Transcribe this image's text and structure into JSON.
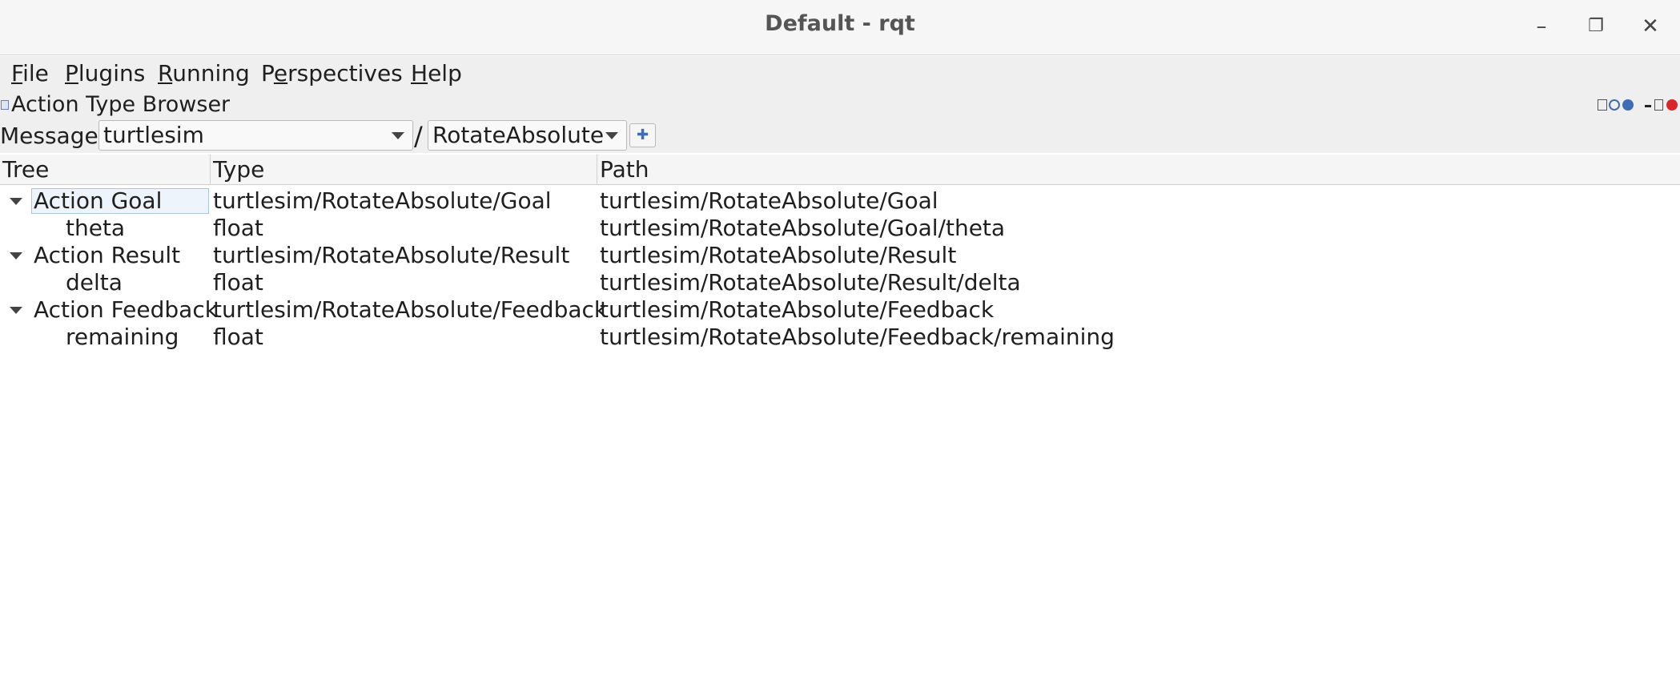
{
  "window": {
    "title": "Default - rqt",
    "minimize_glyph": "–",
    "maximize_glyph": "❐",
    "close_glyph": "✕"
  },
  "menubar": {
    "items": [
      {
        "first": "F",
        "rest": "ile"
      },
      {
        "first": "P",
        "rest": "lugins"
      },
      {
        "first": "R",
        "rest": "unning"
      },
      {
        "pre": "P",
        "first": "e",
        "rest": "rspectives"
      },
      {
        "first": "H",
        "rest": "elp"
      }
    ]
  },
  "plugin": {
    "title": "Action Type Browser"
  },
  "toolbar": {
    "message_label": "Message:",
    "package_value": "turtlesim",
    "separator": "/",
    "action_value": "RotateAbsolute",
    "add_button_glyph": "✚"
  },
  "tree": {
    "columns": [
      "Tree",
      "Type",
      "Path"
    ],
    "rows": [
      {
        "name": "Action Goal",
        "type": "turtlesim/RotateAbsolute/Goal",
        "path": "turtlesim/RotateAbsolute/Goal"
      },
      {
        "name": "theta",
        "type": "float",
        "path": "turtlesim/RotateAbsolute/Goal/theta"
      },
      {
        "name": "Action Result",
        "type": "turtlesim/RotateAbsolute/Result",
        "path": "turtlesim/RotateAbsolute/Result"
      },
      {
        "name": "delta",
        "type": "float",
        "path": "turtlesim/RotateAbsolute/Result/delta"
      },
      {
        "name": "Action Feedback",
        "type": "turtlesim/RotateAbsolute/Feedback",
        "path": "turtlesim/RotateAbsolute/Feedback"
      },
      {
        "name": "remaining",
        "type": "float",
        "path": "turtlesim/RotateAbsolute/Feedback/remaining"
      }
    ]
  },
  "colors": {
    "selection_border": "#a9c4e6",
    "close_icon": "#d9262b",
    "accent_blue": "#3f6db4"
  }
}
